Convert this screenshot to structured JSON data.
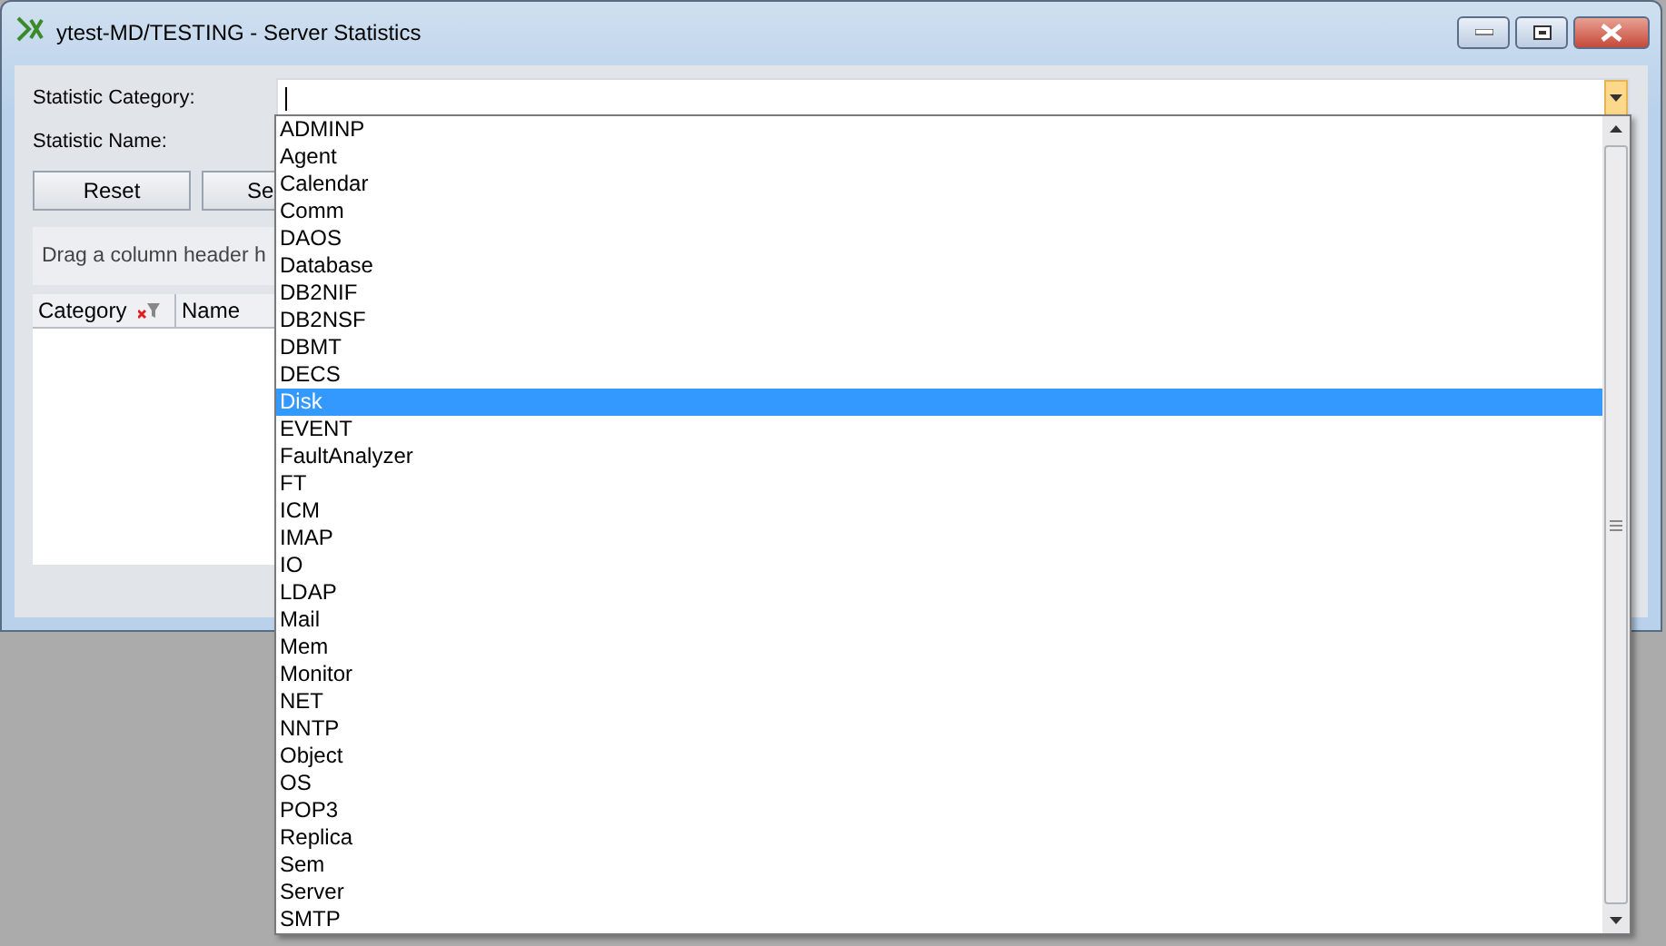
{
  "window": {
    "title": "ytest-MD/TESTING - Server Statistics"
  },
  "form": {
    "category_label": "Statistic Category:",
    "name_label": "Statistic Name:"
  },
  "buttons": [
    "Reset",
    "Se"
  ],
  "group_panel": {
    "hint": "Drag a column header h"
  },
  "grid": {
    "columns": [
      {
        "label": "Category",
        "filter": true
      },
      {
        "label": "Name",
        "filter": false
      }
    ]
  },
  "dropdown": {
    "items": [
      {
        "label": "ADMINP",
        "selected": false
      },
      {
        "label": "Agent",
        "selected": false
      },
      {
        "label": "Calendar",
        "selected": false
      },
      {
        "label": "Comm",
        "selected": false
      },
      {
        "label": "DAOS",
        "selected": false
      },
      {
        "label": "Database",
        "selected": false
      },
      {
        "label": "DB2NIF",
        "selected": false
      },
      {
        "label": "DB2NSF",
        "selected": false
      },
      {
        "label": "DBMT",
        "selected": false
      },
      {
        "label": "DECS",
        "selected": false
      },
      {
        "label": "Disk",
        "selected": true
      },
      {
        "label": "EVENT",
        "selected": false
      },
      {
        "label": "FaultAnalyzer",
        "selected": false
      },
      {
        "label": "FT",
        "selected": false
      },
      {
        "label": "ICM",
        "selected": false
      },
      {
        "label": "IMAP",
        "selected": false
      },
      {
        "label": "IO",
        "selected": false
      },
      {
        "label": "LDAP",
        "selected": false
      },
      {
        "label": "Mail",
        "selected": false
      },
      {
        "label": "Mem",
        "selected": false
      },
      {
        "label": "Monitor",
        "selected": false
      },
      {
        "label": "NET",
        "selected": false
      },
      {
        "label": "NNTP",
        "selected": false
      },
      {
        "label": "Object",
        "selected": false
      },
      {
        "label": "OS",
        "selected": false
      },
      {
        "label": "POP3",
        "selected": false
      },
      {
        "label": "Replica",
        "selected": false
      },
      {
        "label": "Sem",
        "selected": false
      },
      {
        "label": "Server",
        "selected": false
      },
      {
        "label": "SMTP",
        "selected": false
      }
    ]
  }
}
